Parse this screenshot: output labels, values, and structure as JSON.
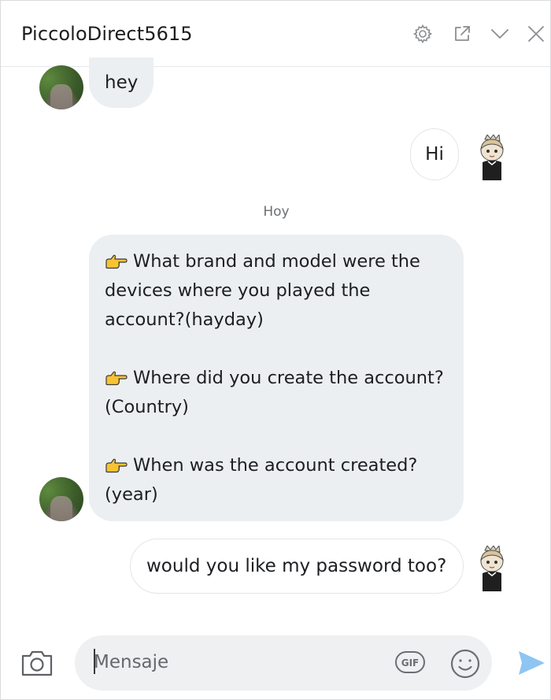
{
  "header": {
    "title": "PiccoloDirect5615",
    "icons": [
      "gear-icon",
      "pop-out-icon",
      "chevron-down-icon",
      "close-icon"
    ]
  },
  "messages": [
    {
      "side": "incoming",
      "text": "hey"
    },
    {
      "side": "outgoing",
      "text": "Hi"
    }
  ],
  "date_separator": "Hoy",
  "question_message": {
    "side": "incoming",
    "items": [
      {
        "icon": "pointing-hand-icon",
        "text": "What brand and model were the devices where you played the account?(hayday)"
      },
      {
        "icon": "pointing-hand-icon",
        "text": "Where did you create the account? (Country)"
      },
      {
        "icon": "pointing-hand-icon",
        "text": "When was the account created? (year)"
      }
    ]
  },
  "reply_message": {
    "side": "outgoing",
    "text": "would you like my password too?"
  },
  "composer": {
    "placeholder": "Mensaje",
    "gif_label": "GIF",
    "icons": [
      "camera-icon",
      "gif-icon",
      "emoji-icon",
      "send-icon"
    ]
  },
  "colors": {
    "incoming_bubble": "#eceff1",
    "outgoing_bubble_border": "#e3e5e8",
    "send_accent": "#8ec5f2",
    "hand_yellow": "#f7c333"
  }
}
